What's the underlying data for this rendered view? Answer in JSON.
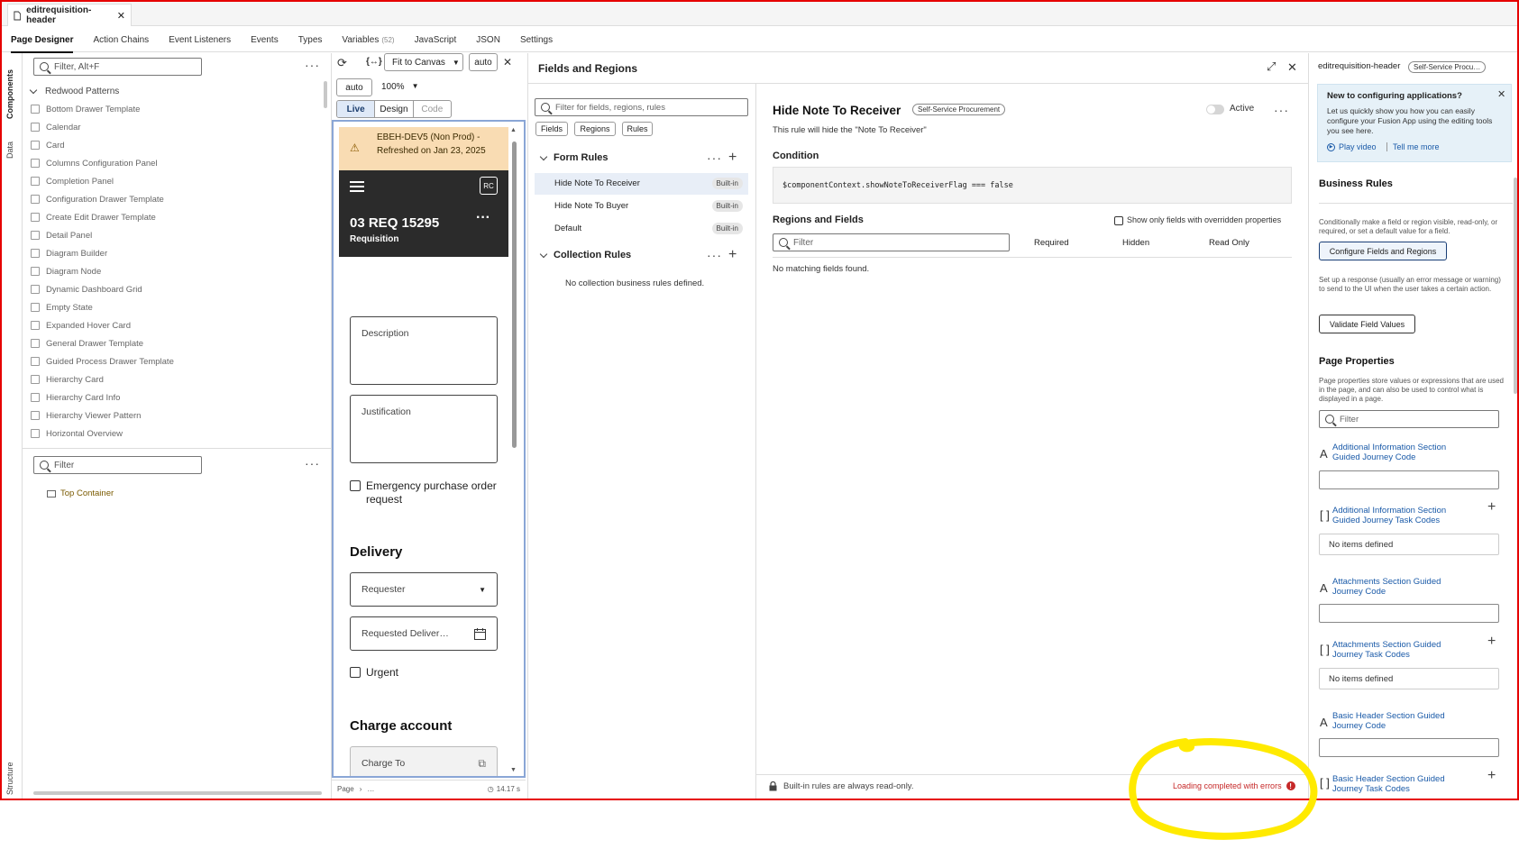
{
  "file_tab": {
    "title": "editrequisition-header"
  },
  "top_tabs": [
    {
      "label": "Page Designer",
      "count": ""
    },
    {
      "label": "Action Chains",
      "count": ""
    },
    {
      "label": "Event Listeners",
      "count": ""
    },
    {
      "label": "Events",
      "count": ""
    },
    {
      "label": "Types",
      "count": ""
    },
    {
      "label": "Variables",
      "count": "(52)"
    },
    {
      "label": "JavaScript",
      "count": ""
    },
    {
      "label": "JSON",
      "count": ""
    },
    {
      "label": "Settings",
      "count": ""
    }
  ],
  "side_tabs": {
    "components": "Components",
    "data": "Data",
    "structure": "Structure"
  },
  "components": {
    "filter_placeholder": "Filter, Alt+F",
    "group": "Redwood Patterns",
    "items": [
      "Bottom Drawer Template",
      "Calendar",
      "Card",
      "Columns Configuration Panel",
      "Completion Panel",
      "Configuration Drawer Template",
      "Create Edit Drawer Template",
      "Detail Panel",
      "Diagram Builder",
      "Diagram Node",
      "Dynamic Dashboard Grid",
      "Empty State",
      "Expanded Hover Card",
      "General Drawer Template",
      "Guided Process Drawer Template",
      "Hierarchy Card",
      "Hierarchy Card Info",
      "Hierarchy Viewer Pattern",
      "Horizontal Overview"
    ]
  },
  "structure": {
    "filter_placeholder": "Filter",
    "root": "Top Container"
  },
  "toolbar": {
    "fit": "Fit to Canvas",
    "auto1": "auto",
    "auto2": "auto",
    "zoom": "100%",
    "live": "Live",
    "design": "Design",
    "code": "Code"
  },
  "preview": {
    "banner": "EBEH-DEV5 (Non Prod) - Refreshed on Jan 23, 2025",
    "avatar": "RC",
    "req_title": "03 REQ 15295",
    "req_subtitle": "Requisition",
    "description": "Description",
    "justification": "Justification",
    "emergency": "Emergency purchase order request",
    "delivery": "Delivery",
    "requester": "Requester",
    "requested_delivery": "Requested Deliver…",
    "urgent": "Urgent",
    "charge_account": "Charge account",
    "charge_to": "Charge To"
  },
  "status_bar": {
    "crumb": "Page",
    "crumb2": "…",
    "timer": "14.17 s"
  },
  "fields_regions": {
    "title": "Fields and Regions",
    "filter_placeholder": "Filter for fields, regions, rules",
    "tabs": [
      "Fields",
      "Regions",
      "Rules"
    ],
    "form_rules_title": "Form Rules",
    "form_rules": [
      {
        "name": "Hide Note To Receiver",
        "badge": "Built-in"
      },
      {
        "name": "Hide Note To Buyer",
        "badge": "Built-in"
      },
      {
        "name": "Default",
        "badge": "Built-in"
      }
    ],
    "collection_rules_title": "Collection Rules",
    "collection_empty": "No collection business rules defined."
  },
  "rule_detail": {
    "title": "Hide Note To Receiver",
    "badge": "Self-Service Procurement",
    "active_label": "Active",
    "description": "This rule will hide the \"Note To Receiver\"",
    "condition_title": "Condition",
    "condition_code": "$componentContext.showNoteToReceiverFlag === false",
    "regions_title": "Regions and Fields",
    "show_only": "Show only fields with overridden properties",
    "filter_placeholder": "Filter",
    "col_required": "Required",
    "col_hidden": "Hidden",
    "col_readonly": "Read Only",
    "empty": "No matching fields found.",
    "footer_note": "Built-in rules are always read-only.",
    "footer_status": "Loading completed with errors"
  },
  "properties": {
    "page_name": "editrequisition-header",
    "page_badge": "Self-Service Procu…",
    "info_title": "New to configuring applications?",
    "info_text": "Let us quickly show you how you can easily configure your Fusion App using the editing tools you see here.",
    "play_video": "Play video",
    "tell_more": "Tell me more",
    "business_rules_title": "Business Rules",
    "business_rules_text": "Conditionally make a field or region visible, read-only, or required, or set a default value for a field.",
    "configure_button": "Configure Fields and Regions",
    "validate_text": "Set up a response (usually an error message or warning) to send to the UI when the user takes a certain action.",
    "validate_button": "Validate Field Values",
    "page_properties_title": "Page Properties",
    "page_properties_text": "Page properties store values or expressions that are used in the page, and can also be used to control what is displayed in a page.",
    "filter_placeholder": "Filter",
    "items": [
      {
        "kind": "text",
        "label": "Additional Information Section Guided Journey Code"
      },
      {
        "kind": "array",
        "label": "Additional Information Section Guided Journey Task Codes",
        "empty": "No items defined"
      },
      {
        "kind": "text",
        "label": "Attachments Section Guided Journey Code"
      },
      {
        "kind": "array",
        "label": "Attachments Section Guided Journey Task Codes",
        "empty": "No items defined"
      },
      {
        "kind": "text",
        "label": "Basic Header Section Guided Journey Code"
      },
      {
        "kind": "array",
        "label": "Basic Header Section Guided Journey Task Codes"
      }
    ]
  },
  "colors": {
    "annotation": "#ffea00",
    "frame": "#e60000",
    "banner": "#f9dcb3",
    "header_dark": "#2b2b2b",
    "link": "#1a5aa8",
    "error": "#c62828"
  }
}
